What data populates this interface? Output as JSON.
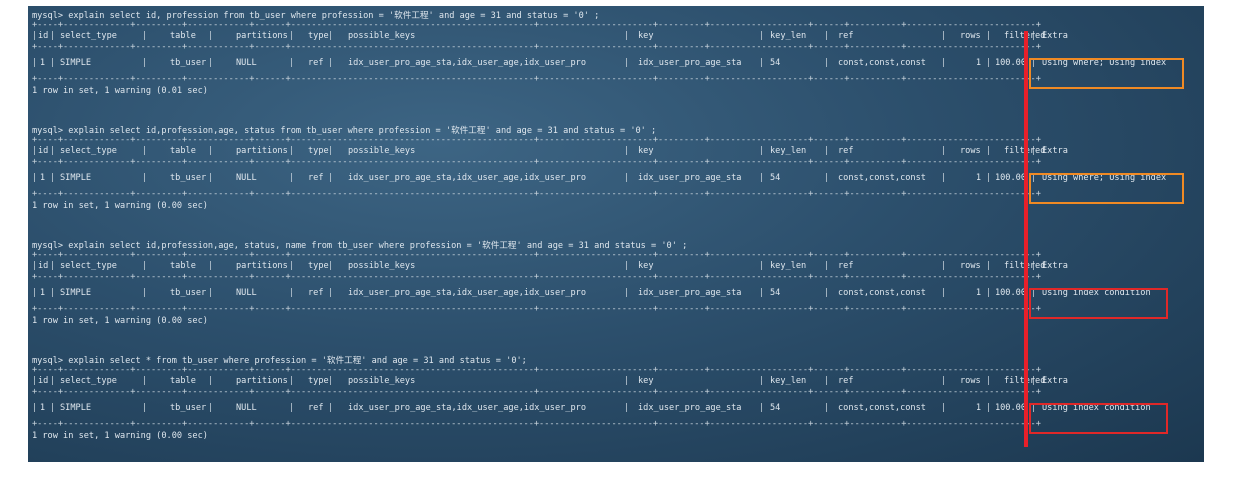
{
  "colors": {
    "terminal_bg": "#2c4f6c",
    "highlight_orange": "#f08a24",
    "highlight_red": "#e02828",
    "divider_red": "#e8202a"
  },
  "headers": [
    "id",
    "select_type",
    "table",
    "partitions",
    "type",
    "possible_keys",
    "key",
    "key_len",
    "ref",
    "rows",
    "filtered",
    "Extra"
  ],
  "queries": [
    {
      "command": "mysql> explain select id, profession from tb_user where profession = '软件工程' and age = 31 and status = '0' ;",
      "row": [
        "1",
        "SIMPLE",
        "tb_user",
        "NULL",
        "ref",
        "idx_user_pro_age_sta,idx_user_age,idx_user_pro",
        "idx_user_pro_age_sta",
        "54",
        "const,const,const",
        "1",
        "100.00",
        "Using where; Using index"
      ],
      "footer": "1 row in set, 1 warning (0.01 sec)"
    },
    {
      "command": "mysql> explain select id,profession,age, status from tb_user where profession = '软件工程' and age = 31 and status = '0' ;",
      "row": [
        "1",
        "SIMPLE",
        "tb_user",
        "NULL",
        "ref",
        "idx_user_pro_age_sta,idx_user_age,idx_user_pro",
        "idx_user_pro_age_sta",
        "54",
        "const,const,const",
        "1",
        "100.00",
        "Using where; Using index"
      ],
      "footer": "1 row in set, 1 warning (0.00 sec)"
    },
    {
      "command": "mysql> explain select id,profession,age, status, name from tb_user where profession = '软件工程' and age = 31 and status = '0' ;",
      "row": [
        "1",
        "SIMPLE",
        "tb_user",
        "NULL",
        "ref",
        "idx_user_pro_age_sta,idx_user_age,idx_user_pro",
        "idx_user_pro_age_sta",
        "54",
        "const,const,const",
        "1",
        "100.00",
        "Using index condition"
      ],
      "footer": "1 row in set, 1 warning (0.00 sec)"
    },
    {
      "command": "mysql> explain select * from tb_user where profession = '软件工程' and age = 31 and status = '0';",
      "row": [
        "1",
        "SIMPLE",
        "tb_user",
        "NULL",
        "ref",
        "idx_user_pro_age_sta,idx_user_age,idx_user_pro",
        "idx_user_pro_age_sta",
        "54",
        "const,const,const",
        "1",
        "100.00",
        "Using index condition"
      ],
      "footer": "1 row in set, 1 warning (0.00 sec)"
    }
  ]
}
